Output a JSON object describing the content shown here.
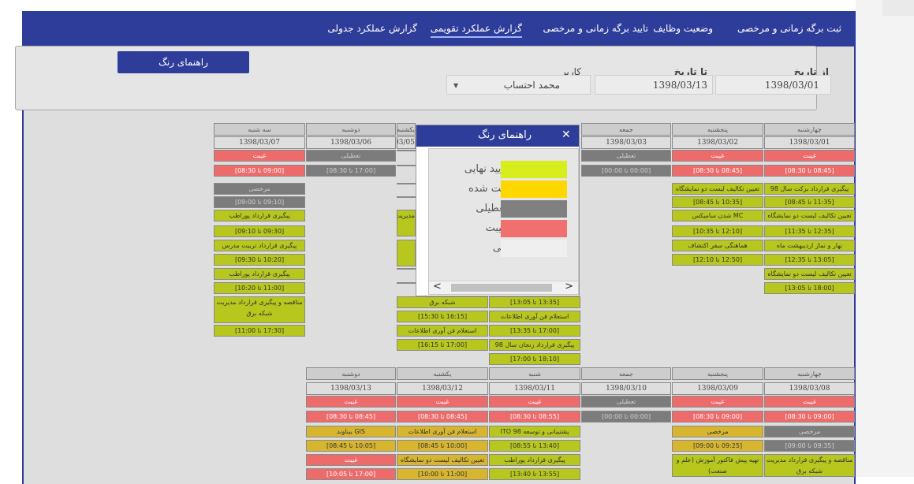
{
  "nav": {
    "items": [
      "ثبت برگه زمانی و مرخصی",
      "وضعیت وظایف",
      "تایید برگه زمانی و مرخصی",
      "گزارش عملکرد تقویمی",
      "گزارش عملکرد جدولی"
    ],
    "active": "گزارش عملکرد تقویمی"
  },
  "filter": {
    "from_label": "از تاریخ",
    "from_value": "1398/03/01",
    "to_label": "تا تاریخ",
    "to_value": "1398/03/13",
    "user_label": "کاربر",
    "user_value": "محمد احتساب",
    "color_guide_button": "راهنمای رنگ"
  },
  "calendar": {
    "week1": {
      "columns": [
        {
          "day": "چهارشنبه",
          "date": "1398/03/01",
          "cells": [
            "غیبت",
            "[08:45 تا 08:30]",
            "پیگیری قرارداد برکت سال 98",
            "[11:35 تا 08:45]",
            "تعیین تکالیف لیست دو نمایشگاه",
            "[12:35 تا 11:35]",
            "نهار و نماز اردیبهشت ماه",
            "[13:05 تا 12:35]",
            "تعیین تکالیف لیست دو نمایشگاه",
            "[18:00 تا 13:05]"
          ]
        },
        {
          "day": "پنجشنبه",
          "date": "1398/03/02",
          "cells": [
            "غیبت",
            "[08:45 تا 08:30]",
            "تعیین تکالیف لیست دو نمایشگاه",
            "[10:35 تا 08:45]",
            "MC شدن سامیکس",
            "[12:10 تا 10:35]",
            "هماهنگی سفر اکتشاف",
            "[12:50 تا 12:10]"
          ]
        },
        {
          "day": "جمعه",
          "date": "1398/03/03",
          "cells": [
            "تعطیلی",
            "[00:00 تا 00:00]"
          ]
        },
        {
          "day": "شنبه",
          "date": "1398/03/04",
          "cells": [
            "شبکه برق",
            "[13:35 تا 13:05]",
            "استعلام فن آوری اطلاعات",
            "[17:00 تا 13:35]",
            "پیگیری قرارداد زنجان سال 98",
            "[18:10 تا 17:00]"
          ]
        },
        {
          "day": "یکشنبه",
          "date": "1398/03/05",
          "cells": [
            "مدیریت",
            "شبکه برق",
            "[16:15 تا 15:30]",
            "استعلام فن آوری اطلاعات",
            "[17:00 تا 16:15]"
          ]
        },
        {
          "day": "دوشنبه",
          "date": "1398/03/06",
          "cells": [
            "تعطیلی",
            "[17:00 تا 08:30]"
          ]
        },
        {
          "day": "سه شنبه",
          "date": "1398/03/07",
          "cells": [
            "غیبت",
            "[09:00 تا 08:30]",
            "مرخصی",
            "[09:10 تا 09:00]",
            "پیگیری قرارداد پوراطب",
            "[09:30 تا 09:10]",
            "پیگیری قرارداد تربیت مدرس",
            "[10:20 تا 09:30]",
            "پیگیری قرارداد پوراطب",
            "[11:00 تا 10:20]",
            "مناقصه و پیگیری قرارداد مدیریت شبکه برق",
            "[17:30 تا 11:00]"
          ]
        }
      ]
    },
    "week2": {
      "columns": [
        {
          "day": "چهارشنبه",
          "date": "1398/03/08",
          "cells": [
            "غیبت",
            "[09:00 تا 08:30]",
            "مرخصی",
            "[09:35 تا 09:00]",
            "مناقصه و پیگیری قرارداد مدیریت شبکه برق"
          ]
        },
        {
          "day": "پنجشنبه",
          "date": "1398/03/09",
          "cells": [
            "غیبت",
            "[09:00 تا 08:30]",
            "مرخصی",
            "[09:25 تا 09:00]",
            "تهیه پیش فاکتور آموزش (علم و صنعت)"
          ]
        },
        {
          "day": "جمعه",
          "date": "1398/03/10",
          "cells": [
            "تعطیلی",
            "[00:00 تا 00:00]"
          ]
        },
        {
          "day": "شنبه",
          "date": "1398/03/11",
          "cells": [
            "غیبت",
            "[08:55 تا 08:30]",
            "پشتیبانی و توسعه ITO 98",
            "[13:40 تا 08:55]",
            "پیگیری قرارداد پوراطب",
            "[13:55 تا 13:40]"
          ]
        },
        {
          "day": "یکشنبه",
          "date": "1398/03/12",
          "cells": [
            "غیبت",
            "[08:45 تا 08:30]",
            "استعلام فن آوری اطلاعات",
            "[10:00 تا 08:45]",
            "تعیین تکالیف لیست دو نمایشگاه",
            "[11:00 تا 10:00]"
          ]
        },
        {
          "day": "دوشنبه",
          "date": "1398/03/13",
          "cells": [
            "غیبت",
            "[08:45 تا 08:30]",
            "GIS بیناوند",
            "[10:05 تا 08:45]",
            "غیبت",
            "[17:00 تا 10:05]"
          ]
        }
      ]
    }
  },
  "dialog": {
    "title": "راهنمای رنگ",
    "legend": [
      {
        "label": "تایید نهایی",
        "color": "#d7ee1c"
      },
      {
        "label": "ثبت شده",
        "color": "#ffd700"
      },
      {
        "label": "تعطیلی",
        "color": "#808080"
      },
      {
        "label": "غیبت",
        "color": "#f07070"
      },
      {
        "label": "آتی",
        "color": "#efefef"
      }
    ]
  }
}
